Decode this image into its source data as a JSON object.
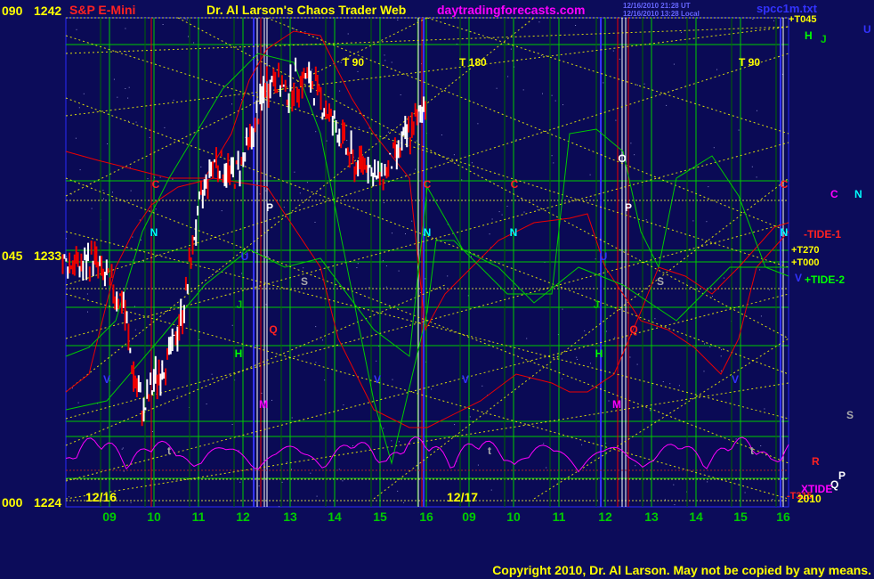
{
  "colors": {
    "background": "#0c0c5a",
    "plot_bg": "#0a0a55",
    "frame": "#2a2aff",
    "yellow": "#ffff00",
    "green": "#00cc00",
    "red": "#ee0000",
    "white": "#ffffff",
    "magenta": "#ff00ff",
    "cyan": "#00ffff",
    "blue": "#3333ff"
  },
  "header": {
    "symbol": "S&P E-Mini",
    "title": "Dr. Al Larson's Chaos Trader Web",
    "site": "daytradingforecasts.com",
    "timestamp_ut": "12/16/2010 21:28 UT",
    "timestamp_local": "12/16/2010 13:28 Local",
    "file": "spcc1m.txt"
  },
  "footer": {
    "copyright": "Copyright 2010, Dr. Al Larson. May not be copied by any means."
  },
  "chart_data": {
    "type": "candlestick",
    "title": "S&P E-Mini",
    "y_axis": {
      "ylim": [
        1224,
        1242
      ],
      "ticks": [
        {
          "angle": "090",
          "price": "1242",
          "value": 1242
        },
        {
          "angle": "045",
          "price": "1233",
          "value": 1233
        },
        {
          "angle": "000",
          "price": "1224",
          "value": 1224
        }
      ]
    },
    "x_axis": {
      "hour_labels": [
        "09",
        "10",
        "11",
        "12",
        "13",
        "14",
        "15",
        "16",
        "09",
        "10",
        "11",
        "12",
        "13",
        "14",
        "15",
        "16"
      ],
      "date_labels": [
        "12/16",
        "12/17"
      ]
    },
    "price_series_approx": [
      1233.0,
      1232.8,
      1233.2,
      1232.5,
      1232.0,
      1231.5,
      1228.8,
      1227.5,
      1228.6,
      1229.2,
      1230.0,
      1231.4,
      1234.0,
      1235.8,
      1236.8,
      1236.4,
      1236.2,
      1237.0,
      1238.0,
      1239.5,
      1239.8,
      1239.2,
      1239.6,
      1239.8,
      1239.4,
      1238.6,
      1238.0,
      1237.2,
      1236.5,
      1236.8,
      1236.0,
      1236.4,
      1237.0,
      1237.6,
      1238.2,
      1239.2
    ],
    "tide_labels": [
      "-TIDE-1",
      "+TIDE-2",
      "XTIDE"
    ],
    "harmonic_labels": [
      "+T045",
      "+T270",
      "+T000",
      "-T315"
    ],
    "time_markers": [
      "T 90",
      "T 180",
      "T 90"
    ],
    "letter_markers": [
      "C",
      "N",
      "P",
      "S",
      "J",
      "H",
      "V",
      "M",
      "O",
      "U",
      "Q",
      "R",
      "t"
    ],
    "legend_right": [
      "+T045",
      "H",
      "J",
      "U",
      "C",
      "N",
      "-TIDE-1",
      "+T270",
      "+T000",
      "V",
      "+TIDE-2",
      "S",
      "R",
      "P",
      "Q",
      "XTIDE",
      "-T315",
      "2010"
    ]
  }
}
